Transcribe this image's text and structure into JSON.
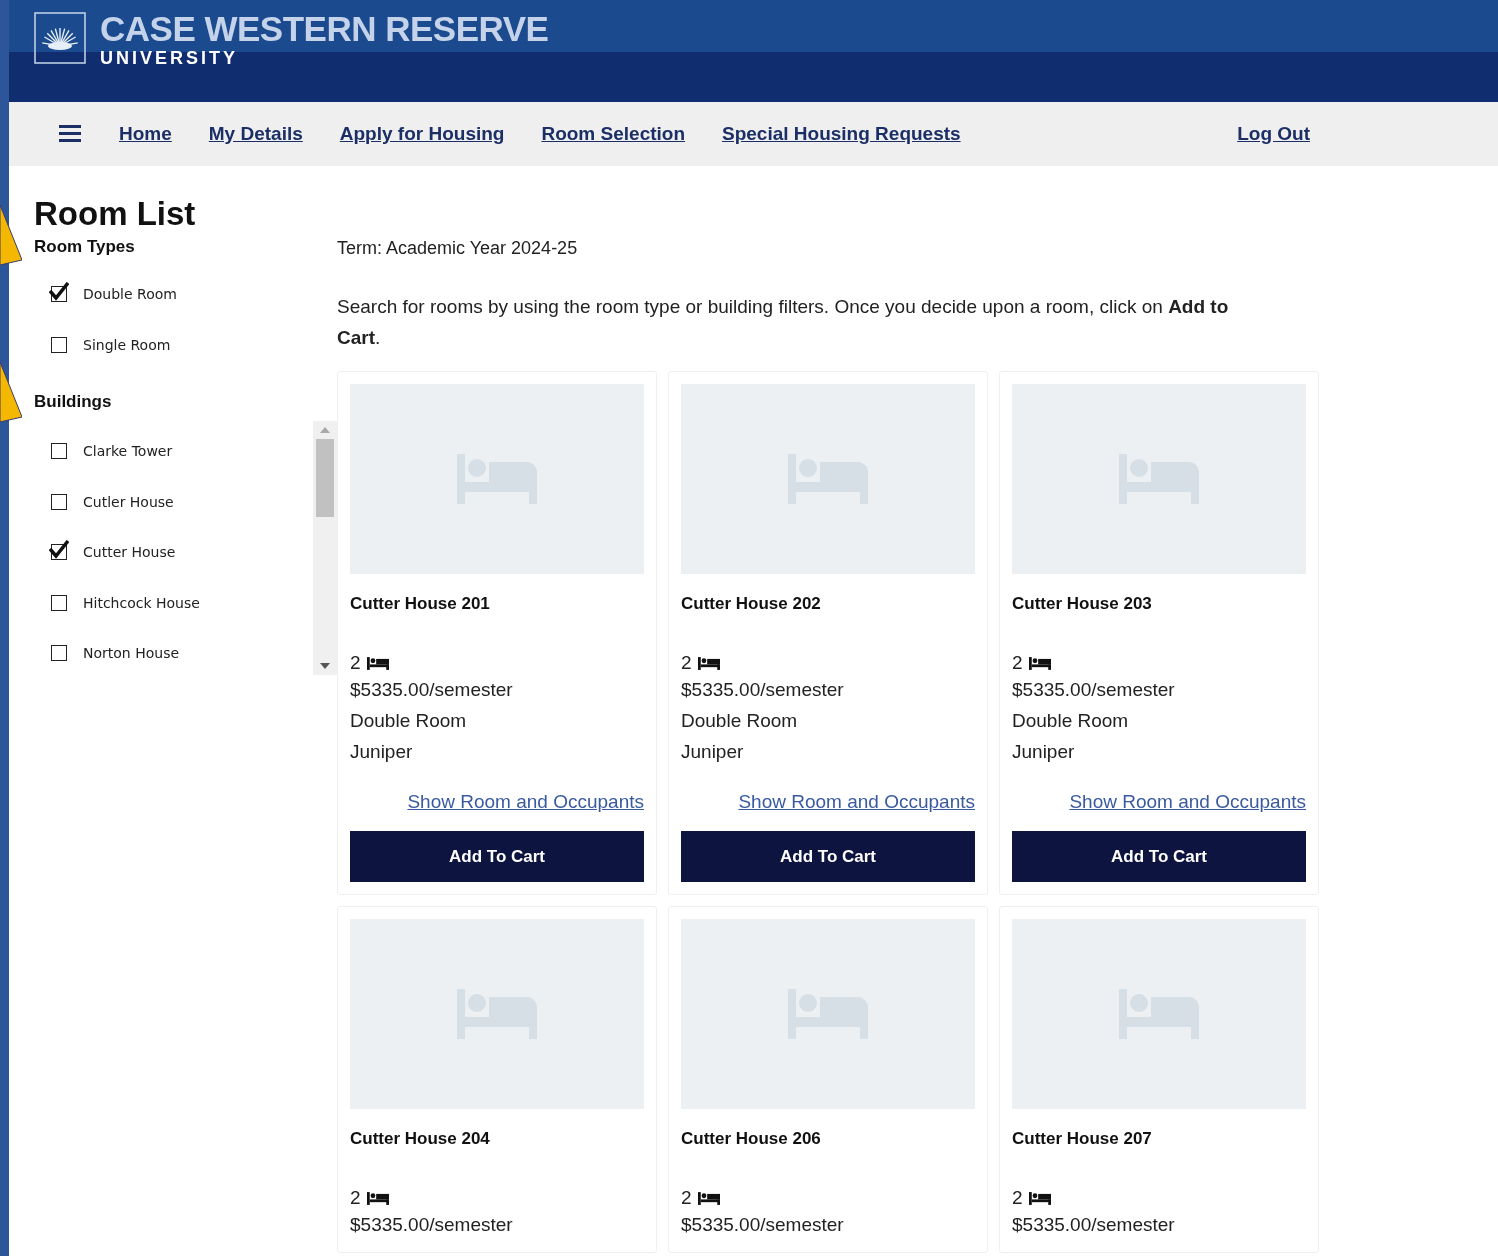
{
  "header": {
    "logo_title": "CASE WESTERN RESERVE",
    "logo_subtitle": "UNIVERSITY"
  },
  "nav": {
    "links": [
      "Home",
      "My Details",
      "Apply for Housing",
      "Room Selection",
      "Special Housing Requests"
    ],
    "logout": "Log Out"
  },
  "page_title": "Room List",
  "filters": [
    {
      "title": "Room Types",
      "scroll": false,
      "items": [
        {
          "label": "Double Room",
          "checked": true
        },
        {
          "label": "Single Room",
          "checked": false
        }
      ]
    },
    {
      "title": "Buildings",
      "scroll": true,
      "items": [
        {
          "label": "Clarke Tower",
          "checked": false
        },
        {
          "label": "Cutler House",
          "checked": false
        },
        {
          "label": "Cutter House",
          "checked": true
        },
        {
          "label": "Hitchcock House",
          "checked": false
        },
        {
          "label": "Norton House",
          "checked": false
        }
      ]
    }
  ],
  "term": "Term: Academic Year 2024-25",
  "instructions": "Search for rooms by using the room type or building filters. Once you decide upon a room, click on **Add to Cart**.",
  "rooms": [
    {
      "name": "Cutter House 201",
      "beds": "2",
      "price": "$5335.00/semester",
      "type": "Double Room",
      "building": "Juniper",
      "link": "Show Room and Occupants",
      "button": "Add To Cart"
    },
    {
      "name": "Cutter House 202",
      "beds": "2",
      "price": "$5335.00/semester",
      "type": "Double Room",
      "building": "Juniper",
      "link": "Show Room and Occupants",
      "button": "Add To Cart"
    },
    {
      "name": "Cutter House 203",
      "beds": "2",
      "price": "$5335.00/semester",
      "type": "Double Room",
      "building": "Juniper",
      "link": "Show Room and Occupants",
      "button": "Add To Cart"
    },
    {
      "name": "Cutter House 204",
      "beds": "2",
      "price": "$5335.00/semester"
    },
    {
      "name": "Cutter House 206",
      "beds": "2",
      "price": "$5335.00/semester"
    },
    {
      "name": "Cutter House 207",
      "beds": "2",
      "price": "$5335.00/semester"
    }
  ]
}
